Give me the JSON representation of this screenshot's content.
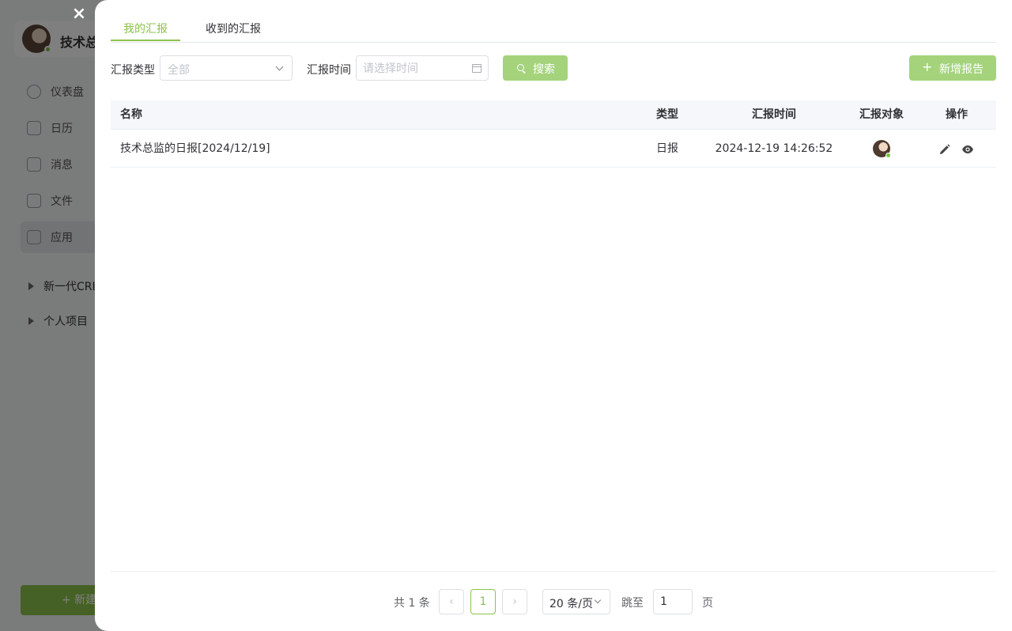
{
  "background": {
    "user_name": "技术总",
    "nav": [
      {
        "label": "仪表盘",
        "icon": "dashboard-icon"
      },
      {
        "label": "日历",
        "icon": "calendar-icon"
      },
      {
        "label": "消息",
        "icon": "message-icon"
      },
      {
        "label": "文件",
        "icon": "file-icon"
      },
      {
        "label": "应用",
        "icon": "apps-icon"
      }
    ],
    "tree": [
      {
        "label": "新一代CRI"
      },
      {
        "label": "个人项目"
      }
    ],
    "new_button": "+ 新建"
  },
  "close_icon": "×",
  "tabs": [
    {
      "label": "我的汇报",
      "active": true
    },
    {
      "label": "收到的汇报",
      "active": false
    }
  ],
  "filter": {
    "type_label": "汇报类型",
    "type_value": "全部",
    "time_label": "汇报时间",
    "time_placeholder": "请选择时间",
    "search_button": "搜索",
    "add_button": "新增报告",
    "add_icon": "+"
  },
  "table": {
    "columns": {
      "name": "名称",
      "type": "类型",
      "time": "汇报时间",
      "target": "汇报对象",
      "ops": "操作"
    },
    "rows": [
      {
        "name": "技术总监的日报[2024/12/19]",
        "type": "日报",
        "time": "2024-12-19 14:26:52"
      }
    ]
  },
  "pagination": {
    "total": "共 1 条",
    "prev": "‹",
    "current": "1",
    "next": "›",
    "page_size": "20 条/页",
    "jump_label": "跳至",
    "jump_value": "1",
    "page_label": "页"
  },
  "colors": {
    "accent": "#8bc34a",
    "button_disabled": "#a4d37c"
  }
}
